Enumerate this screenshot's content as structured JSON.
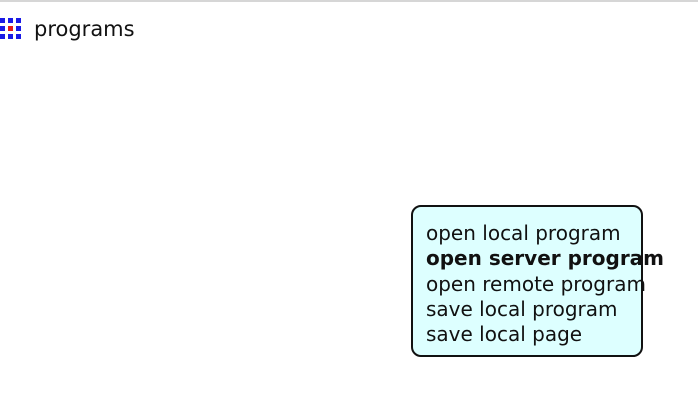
{
  "header": {
    "icon": "grid-icon",
    "title": "programs"
  },
  "colors": {
    "icon_blue": "#1a1ae6",
    "icon_red": "#e61a1a",
    "menu_background": "#ddffff",
    "menu_border": "#111111"
  },
  "menu": {
    "items": [
      {
        "label": "open local program",
        "active": false
      },
      {
        "label": "open server program",
        "active": true
      },
      {
        "label": "open remote program",
        "active": false
      },
      {
        "label": "save local program",
        "active": false
      },
      {
        "label": "save local page",
        "active": false
      }
    ]
  }
}
